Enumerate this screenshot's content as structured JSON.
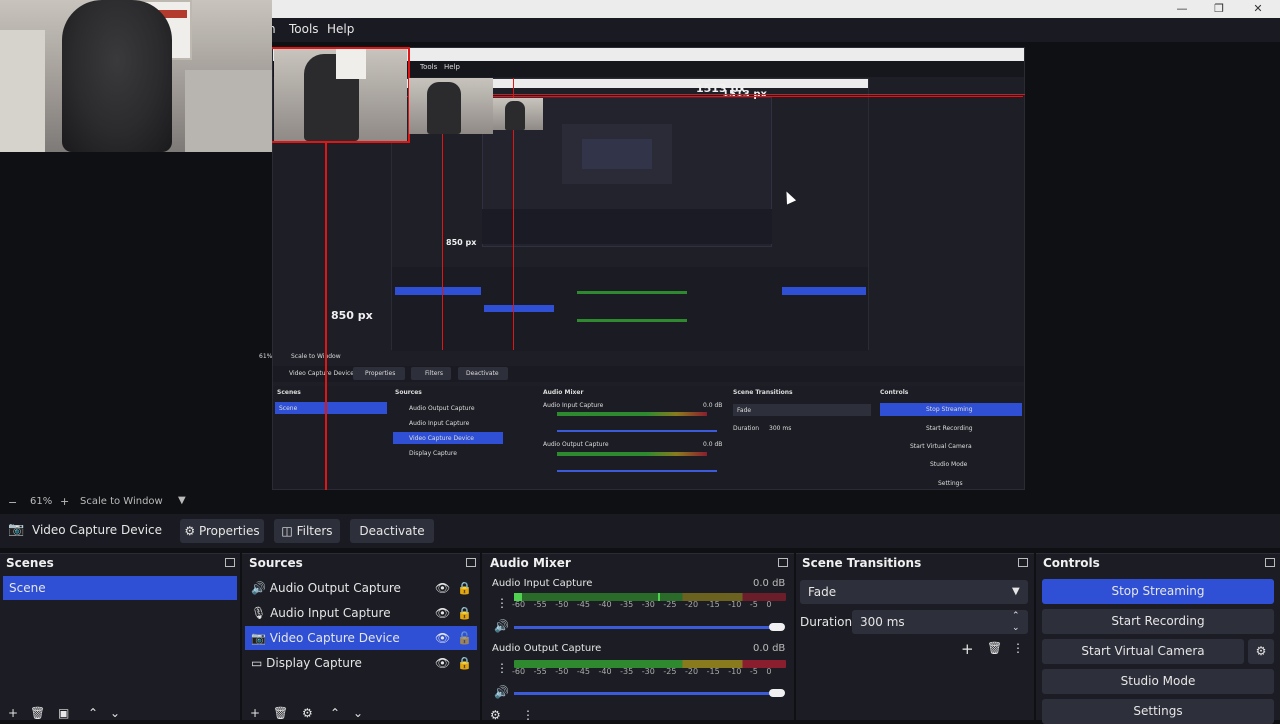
{
  "menu": {
    "tools": "Tools",
    "help": "Help"
  },
  "preview": {
    "width_label": "1513 px",
    "height_label_outer": "850 px",
    "height_label_inner": "850 px",
    "inner_width_label": "1513 px",
    "nested_menu": {
      "tools": "Tools",
      "help": "Help"
    },
    "nested_context": {
      "source": "Video Capture Device",
      "properties": "Properties",
      "filters": "Filters",
      "deactivate": "Deactivate"
    },
    "nested_zoom": "61%",
    "nested_scale": "Scale to Window",
    "nested_scenes_title": "Scenes",
    "nested_scene": "Scene",
    "nested_sources_title": "Sources",
    "nested_sources": [
      "Audio Output Capture",
      "Audio Input Capture",
      "Video Capture Device",
      "Display Capture"
    ],
    "nested_mixer_title": "Audio Mixer",
    "nested_mixer": [
      {
        "name": "Audio Input Capture",
        "db": "0.0 dB"
      },
      {
        "name": "Audio Output Capture",
        "db": "0.0 dB"
      }
    ],
    "nested_transitions_title": "Scene Transitions",
    "nested_transition": "Fade",
    "nested_duration_label": "Duration",
    "nested_duration": "300 ms",
    "nested_controls_title": "Controls",
    "nested_controls": [
      "Stop Streaming",
      "Start Recording",
      "Start Virtual Camera",
      "Studio Mode",
      "Settings"
    ]
  },
  "status": {
    "zoom": "61%",
    "scale_mode": "Scale to Window"
  },
  "context": {
    "source": "Video Capture Device",
    "properties": "Properties",
    "filters": "Filters",
    "deactivate": "Deactivate"
  },
  "scenes": {
    "title": "Scenes",
    "items": [
      "Scene"
    ]
  },
  "sources": {
    "title": "Sources",
    "items": [
      {
        "name": "Audio Output Capture",
        "icon": "speaker-icon"
      },
      {
        "name": "Audio Input Capture",
        "icon": "microphone-icon"
      },
      {
        "name": "Video Capture Device",
        "icon": "camera-icon"
      },
      {
        "name": "Display Capture",
        "icon": "monitor-icon"
      }
    ]
  },
  "mixer": {
    "title": "Audio Mixer",
    "channels": [
      {
        "name": "Audio Input Capture",
        "db": "0.0 dB",
        "level": 0.0
      },
      {
        "name": "Audio Output Capture",
        "db": "0.0 dB",
        "level": 0.0
      }
    ],
    "scale_ticks": [
      "-60",
      "-55",
      "-50",
      "-45",
      "-40",
      "-35",
      "-30",
      "-25",
      "-20",
      "-15",
      "-10",
      "-5",
      "0"
    ]
  },
  "transitions": {
    "title": "Scene Transitions",
    "selected": "Fade",
    "duration_label": "Duration",
    "duration": "300 ms"
  },
  "controls": {
    "title": "Controls",
    "stop_streaming": "Stop Streaming",
    "start_recording": "Start Recording",
    "start_virtual_camera": "Start Virtual Camera",
    "studio_mode": "Studio Mode",
    "settings": "Settings"
  },
  "colors": {
    "accent": "#2f50d4",
    "meter_green": "#2f8a2f",
    "meter_yellow": "#8a7a1e",
    "meter_red": "#8a1e2e",
    "guide_red": "#e01515"
  }
}
